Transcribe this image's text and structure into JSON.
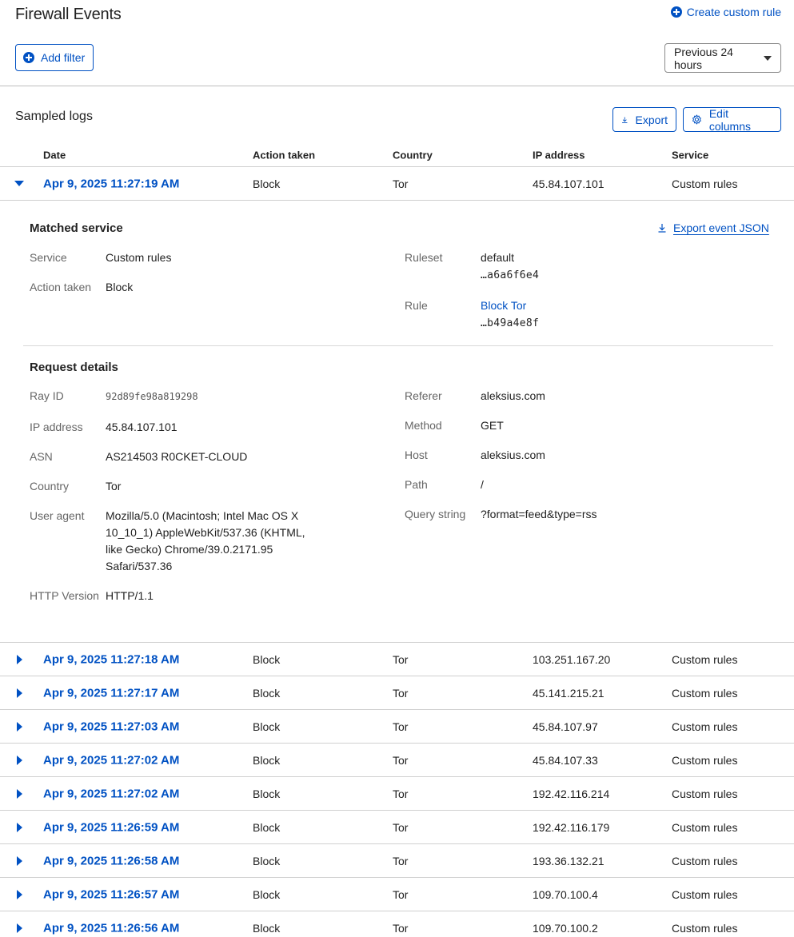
{
  "header": {
    "title": "Firewall Events",
    "create_rule_label": "Create custom rule",
    "add_filter_label": "Add filter",
    "time_range": "Previous 24 hours"
  },
  "sampled_logs": {
    "title": "Sampled logs",
    "export_label": "Export",
    "edit_columns_label": "Edit columns",
    "columns": [
      "Date",
      "Action taken",
      "Country",
      "IP address",
      "Service"
    ],
    "expanded_row": {
      "date": "Apr 9, 2025 11:27:19 AM",
      "action": "Block",
      "country": "Tor",
      "ip": "45.84.107.101",
      "service": "Custom rules"
    },
    "rows": [
      {
        "date": "Apr 9, 2025 11:27:18 AM",
        "action": "Block",
        "country": "Tor",
        "ip": "103.251.167.20",
        "service": "Custom rules"
      },
      {
        "date": "Apr 9, 2025 11:27:17 AM",
        "action": "Block",
        "country": "Tor",
        "ip": "45.141.215.21",
        "service": "Custom rules"
      },
      {
        "date": "Apr 9, 2025 11:27:03 AM",
        "action": "Block",
        "country": "Tor",
        "ip": "45.84.107.97",
        "service": "Custom rules"
      },
      {
        "date": "Apr 9, 2025 11:27:02 AM",
        "action": "Block",
        "country": "Tor",
        "ip": "45.84.107.33",
        "service": "Custom rules"
      },
      {
        "date": "Apr 9, 2025 11:27:02 AM",
        "action": "Block",
        "country": "Tor",
        "ip": "192.42.116.214",
        "service": "Custom rules"
      },
      {
        "date": "Apr 9, 2025 11:26:59 AM",
        "action": "Block",
        "country": "Tor",
        "ip": "192.42.116.179",
        "service": "Custom rules"
      },
      {
        "date": "Apr 9, 2025 11:26:58 AM",
        "action": "Block",
        "country": "Tor",
        "ip": "193.36.132.21",
        "service": "Custom rules"
      },
      {
        "date": "Apr 9, 2025 11:26:57 AM",
        "action": "Block",
        "country": "Tor",
        "ip": "109.70.100.4",
        "service": "Custom rules"
      },
      {
        "date": "Apr 9, 2025 11:26:56 AM",
        "action": "Block",
        "country": "Tor",
        "ip": "109.70.100.2",
        "service": "Custom rules"
      }
    ]
  },
  "matched_service": {
    "title": "Matched service",
    "export_json_label": "Export event JSON",
    "service_label": "Service",
    "service_value": "Custom rules",
    "action_label": "Action taken",
    "action_value": "Block",
    "ruleset_label": "Ruleset",
    "ruleset_name": "default",
    "ruleset_id": "…a6a6f6e4",
    "rule_label": "Rule",
    "rule_name": "Block Tor",
    "rule_id": "…b49a4e8f"
  },
  "request_details": {
    "title": "Request details",
    "ray_id_label": "Ray ID",
    "ray_id": "92d89fe98a819298",
    "ip_label": "IP address",
    "ip": "45.84.107.101",
    "asn_label": "ASN",
    "asn": "AS214503 R0CKET-CLOUD",
    "country_label": "Country",
    "country": "Tor",
    "user_agent_label": "User agent",
    "user_agent_lines": [
      "Mozilla/5.0 (Macintosh; Intel Mac OS X",
      "10_10_1) AppleWebKit/537.36 (KHTML,",
      "like Gecko) Chrome/39.0.2171.95",
      "Safari/537.36"
    ],
    "http_version_label": "HTTP Version",
    "http_version": "HTTP/1.1",
    "referer_label": "Referer",
    "referer": "aleksius.com",
    "method_label": "Method",
    "method": "GET",
    "host_label": "Host",
    "host": "aleksius.com",
    "path_label": "Path",
    "path": "/",
    "query_label": "Query string",
    "query": "?format=feed&type=rss"
  },
  "colors": {
    "accent": "#0051c3",
    "text": "#222222",
    "muted": "#666666",
    "border": "#d0d0d0"
  }
}
